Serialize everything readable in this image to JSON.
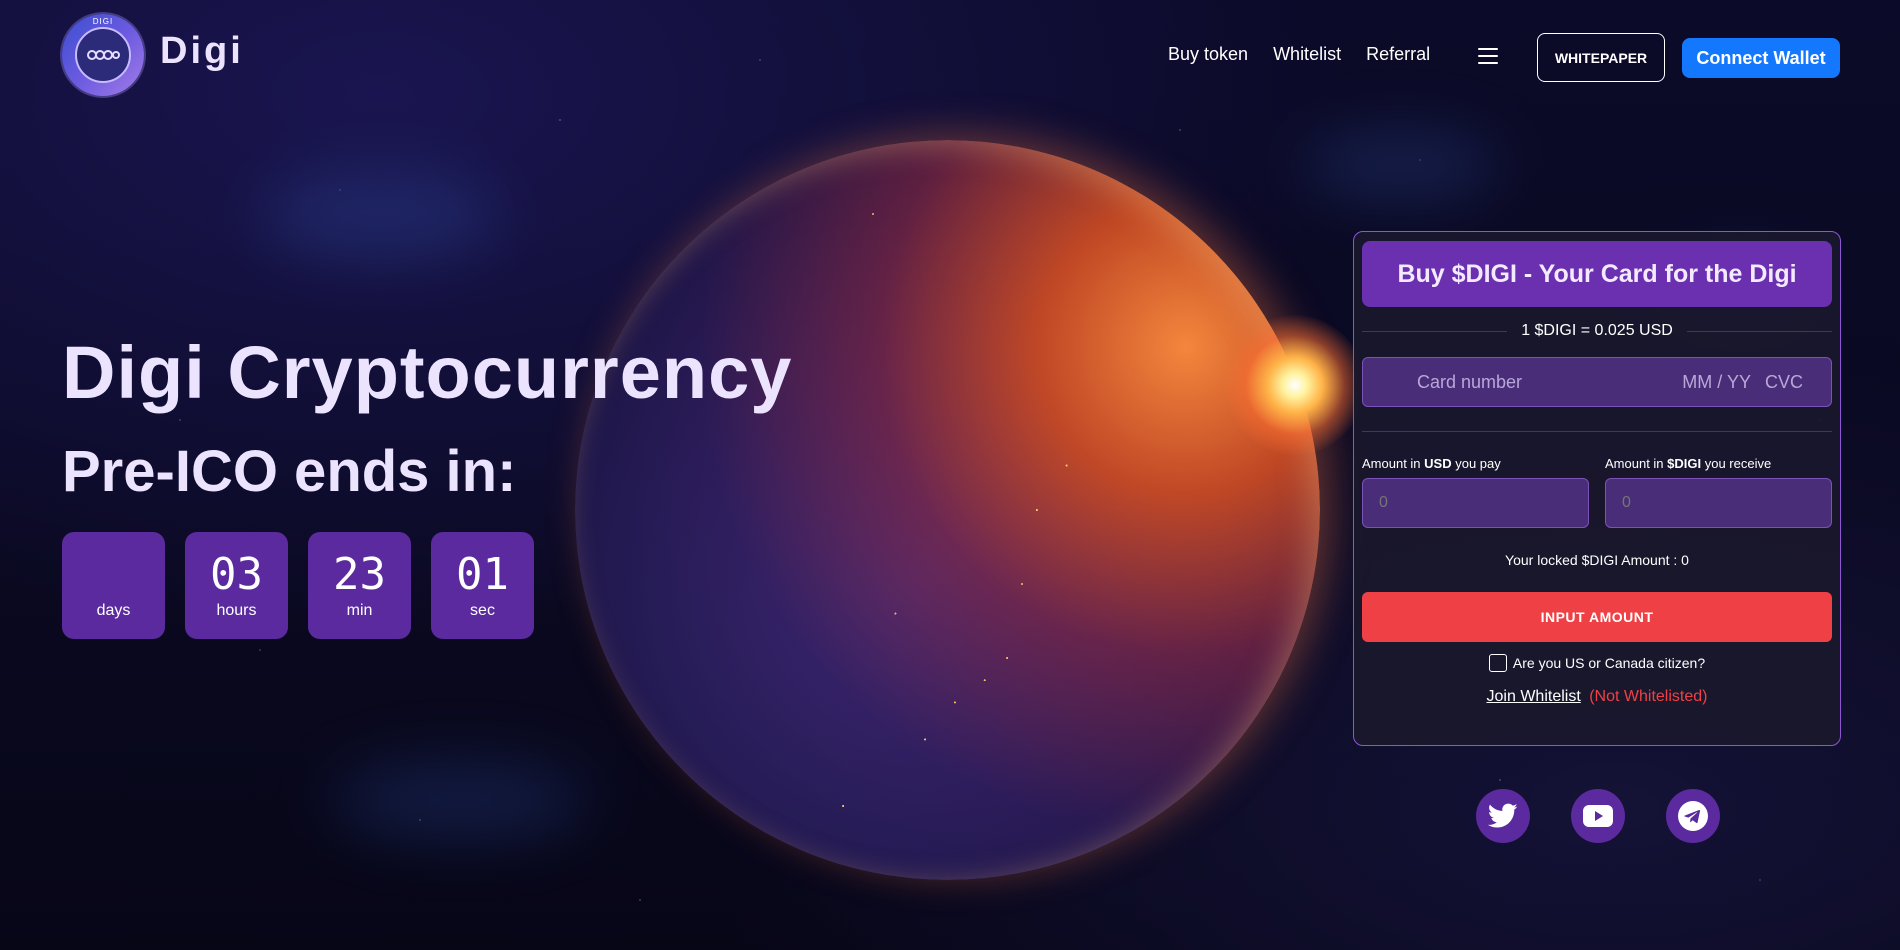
{
  "header": {
    "logo_ring_text": "DIGI",
    "brand": "Digi",
    "nav": [
      "Buy token",
      "Whitelist",
      "Referral"
    ],
    "whitepaper_label": "WHITEPAPER",
    "connect_label": "Connect Wallet"
  },
  "hero": {
    "title": "Digi Cryptocurrency",
    "subtitle": "Pre-ICO ends in:",
    "countdown": [
      {
        "value": "",
        "label": "days"
      },
      {
        "value": "03",
        "label": "hours"
      },
      {
        "value": "23",
        "label": "min"
      },
      {
        "value": "01",
        "label": "sec"
      }
    ]
  },
  "panel": {
    "title": "Buy $DIGI - Your Card for the Digi",
    "rate": "1 $DIGI = 0.025 USD",
    "card": {
      "number_placeholder": "Card number",
      "exp_placeholder": "MM / YY",
      "cvc_placeholder": "CVC"
    },
    "pay": {
      "label_pre": "Amount in ",
      "label_bold": "USD",
      "label_post": " you pay",
      "placeholder": "0"
    },
    "receive": {
      "label_pre": "Amount in ",
      "label_bold": "$DIGI",
      "label_post": " you receive",
      "placeholder": "0"
    },
    "locked": "Your locked $DIGI Amount : 0",
    "button": "INPUT AMOUNT",
    "citizen_label": "Are you US or Canada citizen?",
    "join_label": "Join Whitelist",
    "whitelist_status": "(Not Whitelisted)"
  },
  "social": [
    "twitter-icon",
    "youtube-icon",
    "telegram-icon"
  ],
  "colors": {
    "accent_purple": "#5b2a9e",
    "connect_blue": "#1478ff",
    "cta_red": "#ef4145",
    "heading": "#ece4ff"
  }
}
